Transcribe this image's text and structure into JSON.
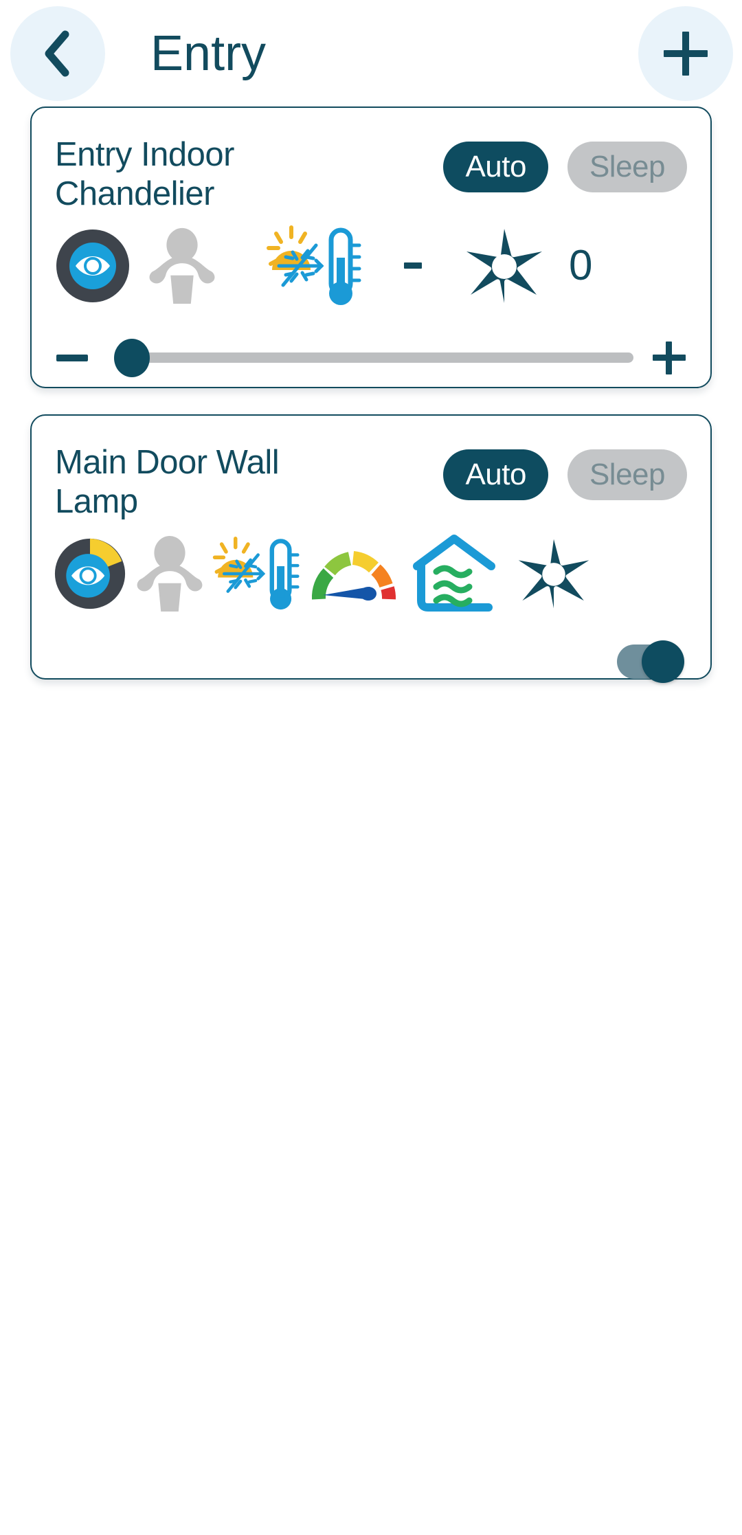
{
  "header": {
    "title": "Entry",
    "back_icon": "chevron-left-icon",
    "add_icon": "plus-icon"
  },
  "devices": [
    {
      "name": "Entry Indoor Chandelier",
      "modes": {
        "auto_label": "Auto",
        "sleep_label": "Sleep",
        "active": "Auto"
      },
      "status_icons": [
        "presence-eye-icon",
        "occupancy-person-icon",
        "temperature-sun-snowflake-icon",
        "separator-dash",
        "brightness-starburst-icon"
      ],
      "brightness_value": "0",
      "slider": {
        "decrease_label": "−",
        "increase_label": "+",
        "value": 0,
        "min": 0,
        "max": 100
      }
    },
    {
      "name": "Main Door Wall Lamp",
      "modes": {
        "auto_label": "Auto",
        "sleep_label": "Sleep",
        "active": "Auto"
      },
      "status_icons": [
        "presence-eye-partial-icon",
        "occupancy-person-icon",
        "temperature-sun-snowflake-icon",
        "air-quality-gauge-icon",
        "indoor-climate-house-icon",
        "brightness-starburst-icon"
      ],
      "power_toggle": {
        "state": "on"
      }
    }
  ],
  "colors": {
    "brand_dark": "#0e4c60",
    "brand_text": "#124b5e",
    "header_circle": "#e9f3fa",
    "pill_inactive_bg": "#c3c5c7",
    "pill_inactive_text": "#778c93",
    "slider_track": "#bcbec0",
    "icon_gray": "#c4c4c4",
    "icon_dark_circle": "#3e444c",
    "icon_blue": "#1aa0da",
    "icon_yellow": "#f5b521",
    "icon_green": "#2aa95c",
    "toggle_track": "#6f8f9c"
  }
}
